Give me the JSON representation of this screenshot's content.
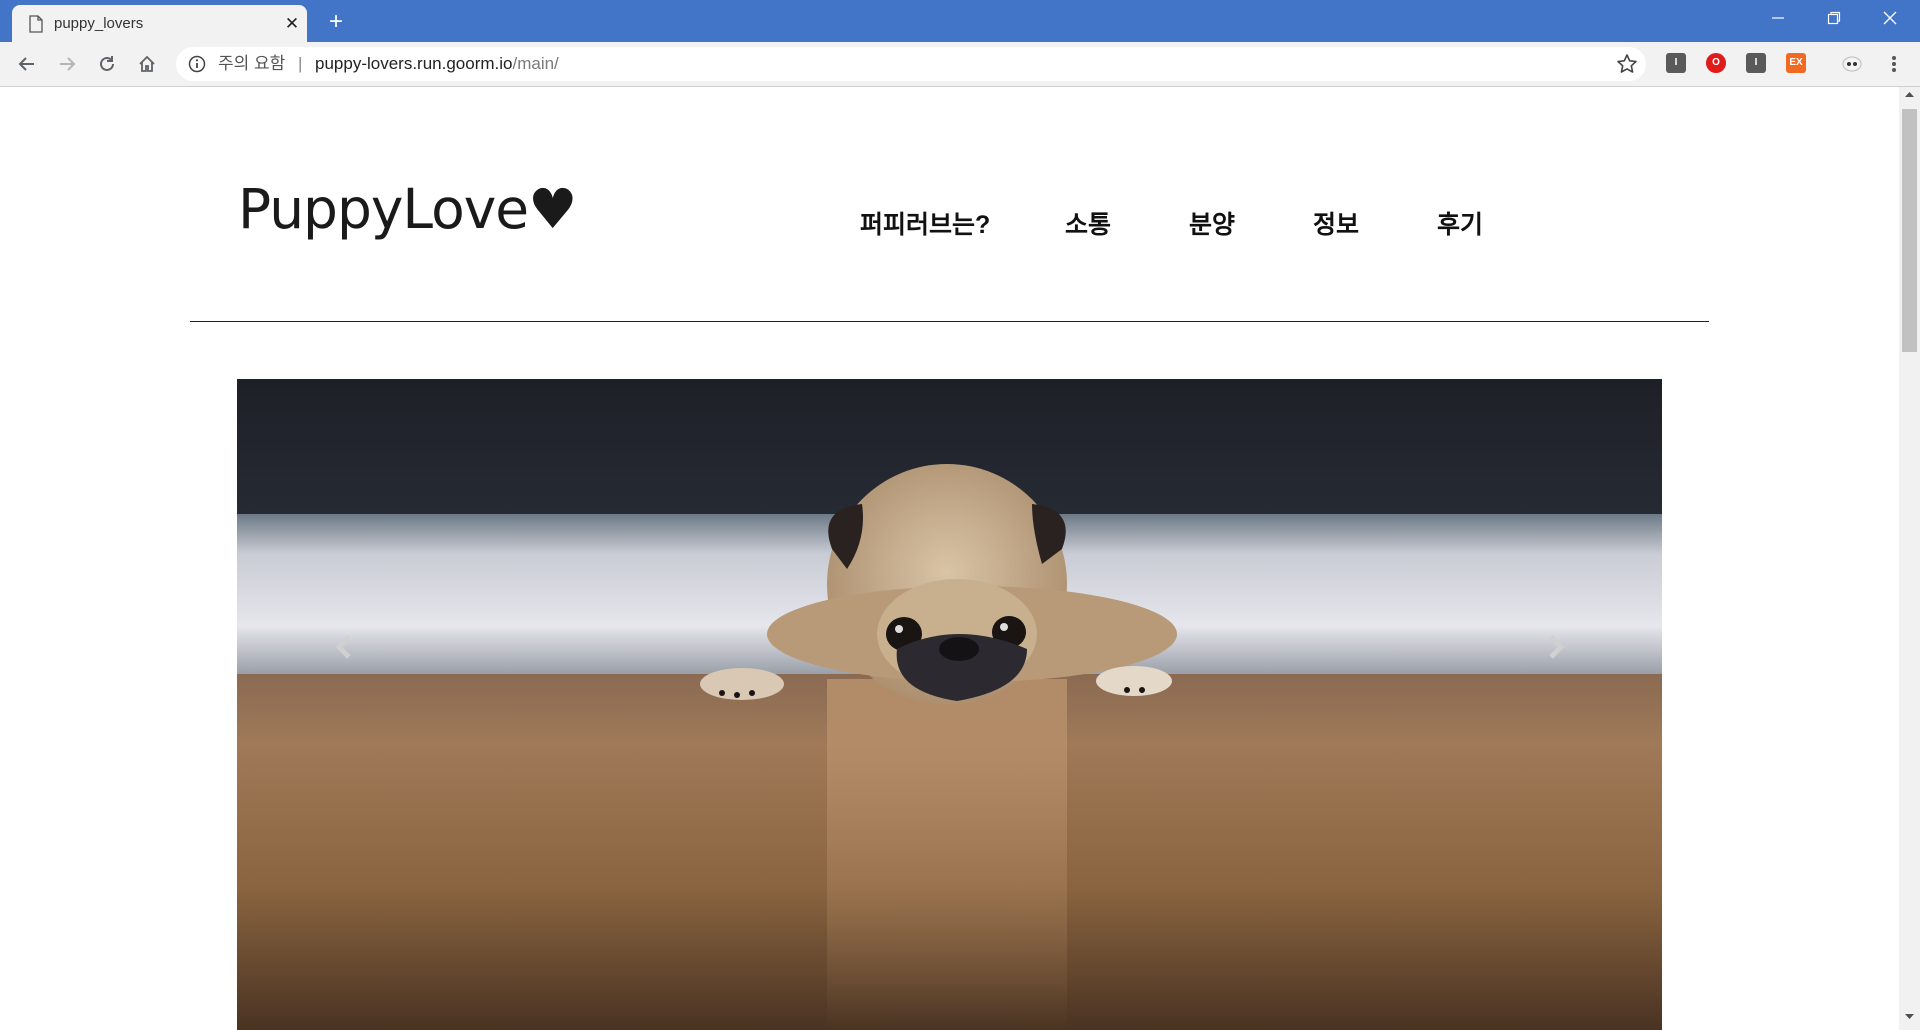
{
  "browser": {
    "tab": {
      "title": "puppy_lovers",
      "close_glyph": "✕"
    },
    "new_tab_glyph": "+",
    "security_label": "주의 요함",
    "separator": "|",
    "url_host": "puppy-lovers.run.goorm.io",
    "url_path": "/main/",
    "extensions": [
      {
        "name": "bookmark-ext-icon",
        "glyph": "I"
      },
      {
        "name": "opera-ext-icon",
        "glyph": "O"
      },
      {
        "name": "reader-ext-icon",
        "glyph": "I"
      },
      {
        "name": "ex-ext-icon",
        "glyph": "EX"
      }
    ],
    "colors": {
      "tabstrip": "#4274c8",
      "toolbar": "#f2f2f2"
    }
  },
  "site": {
    "logo": "PuppyLove♥",
    "nav": [
      "퍼피러브는?",
      "소통",
      "분양",
      "정보",
      "후기"
    ]
  },
  "hero": {
    "image_alt_icon": "pug-photo",
    "prev_icon": "chevron-left-icon",
    "next_icon": "chevron-right-icon"
  }
}
